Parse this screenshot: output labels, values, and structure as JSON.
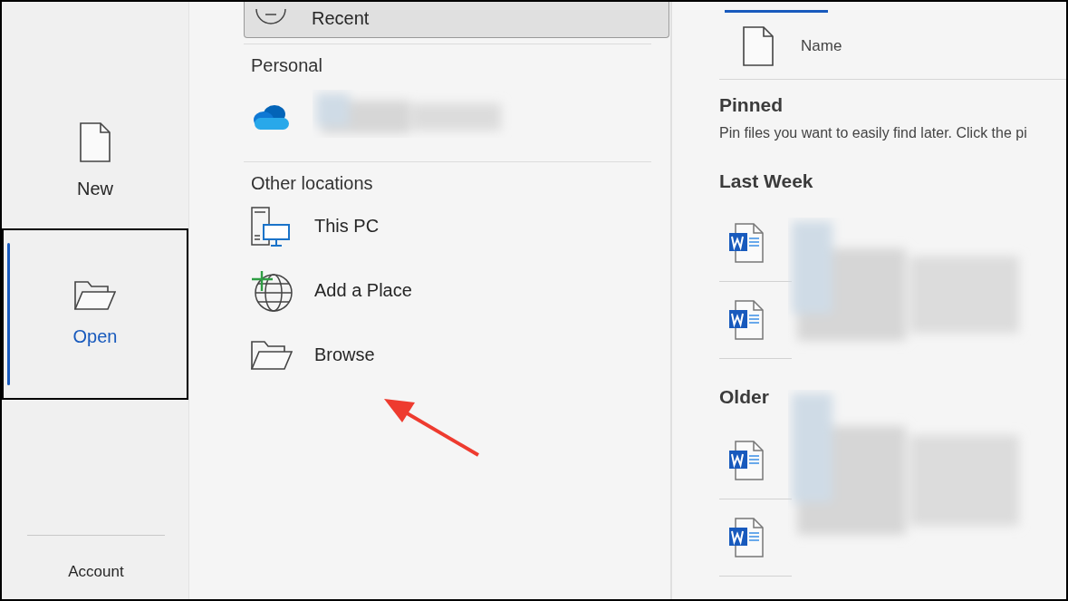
{
  "sidebar": {
    "items": [
      {
        "label": "New",
        "kind": "document",
        "selected": false
      },
      {
        "label": "Open",
        "kind": "folder",
        "selected": true
      }
    ],
    "footer": {
      "label": "Account"
    }
  },
  "locations": {
    "recent": {
      "label": "Recent",
      "selected": true
    },
    "sections": [
      {
        "heading": "Personal",
        "items": [
          {
            "kind": "cloud"
          }
        ]
      },
      {
        "heading": "Other locations",
        "items": [
          {
            "kind": "pc",
            "label": "This PC"
          },
          {
            "kind": "globe",
            "label": "Add a Place"
          },
          {
            "kind": "folder",
            "label": "Browse"
          }
        ]
      }
    ]
  },
  "files": {
    "tab_selected": true,
    "column": "Name",
    "groups": [
      {
        "heading": "Pinned",
        "description": "Pin files you want to easily find later. Click the pi"
      },
      {
        "heading": "Last Week",
        "rows": [
          {
            "kind": "word"
          },
          {
            "kind": "word"
          }
        ]
      },
      {
        "heading": "Older",
        "rows": [
          {
            "kind": "word"
          },
          {
            "kind": "word"
          }
        ]
      }
    ]
  },
  "annotation": {
    "kind": "arrow"
  }
}
